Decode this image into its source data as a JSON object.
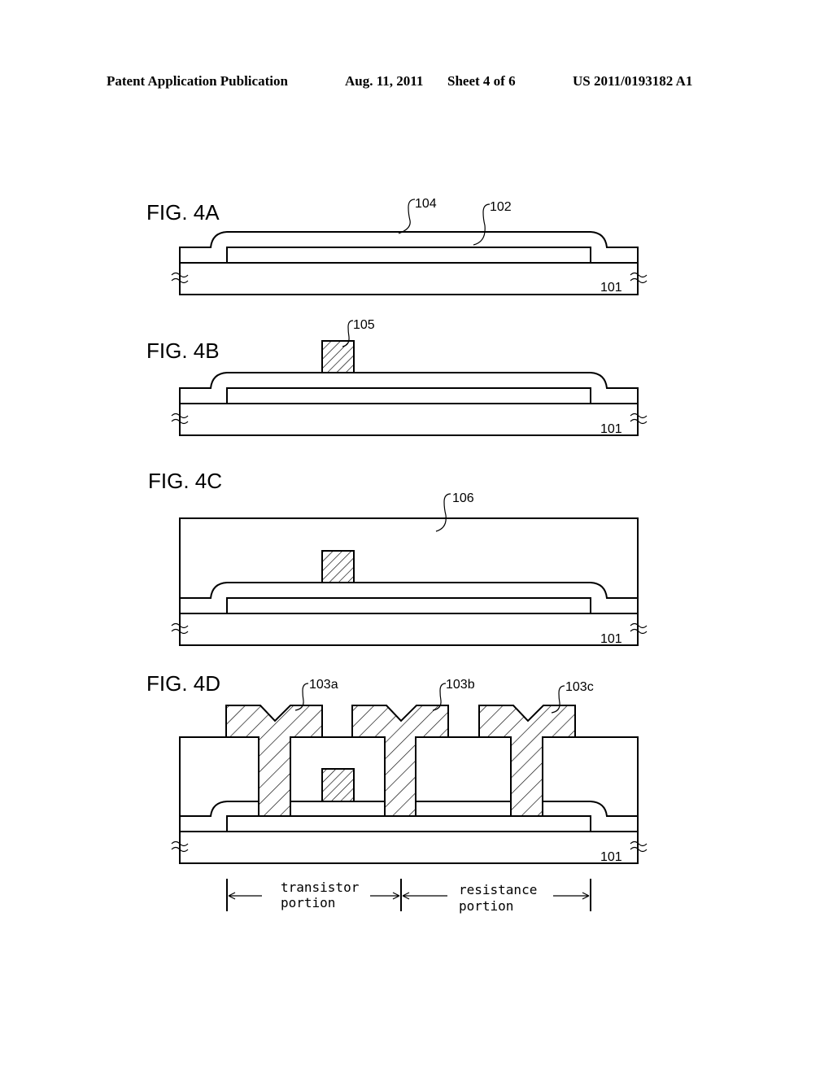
{
  "header": {
    "publication": "Patent Application Publication",
    "date": "Aug. 11, 2011",
    "sheet": "Sheet 4 of 6",
    "number": "US 2011/0193182 A1"
  },
  "figures": [
    {
      "id": "4A",
      "label": "FIG. 4A",
      "refs": [
        "104",
        "102",
        "101"
      ]
    },
    {
      "id": "4B",
      "label": "FIG. 4B",
      "refs": [
        "105",
        "101"
      ]
    },
    {
      "id": "4C",
      "label": "FIG. 4C",
      "refs": [
        "106",
        "101"
      ]
    },
    {
      "id": "4D",
      "label": "FIG. 4D",
      "refs": [
        "103a",
        "103b",
        "103c",
        "101"
      ]
    }
  ],
  "dimensions": {
    "transistor": [
      "transistor",
      "portion"
    ],
    "resistance": [
      "resistance",
      "portion"
    ]
  }
}
